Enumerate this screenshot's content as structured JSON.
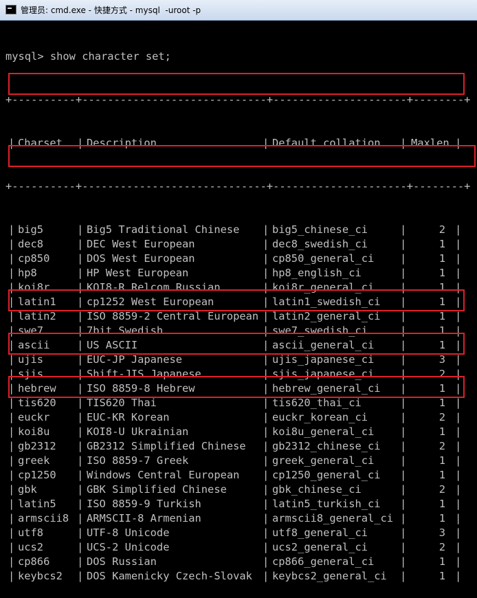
{
  "window": {
    "title": "管理员: cmd.exe - 快捷方式 - mysql  -uroot -p"
  },
  "console": {
    "command": "mysql> show character set;",
    "border": "+----------+-----------------------------+---------------------+--------+",
    "columns": [
      "Charset",
      "Description",
      "Default collation",
      "Maxlen"
    ],
    "rows": [
      [
        "big5",
        "Big5 Traditional Chinese",
        "big5_chinese_ci",
        "2"
      ],
      [
        "dec8",
        "DEC West European",
        "dec8_swedish_ci",
        "1"
      ],
      [
        "cp850",
        "DOS West European",
        "cp850_general_ci",
        "1"
      ],
      [
        "hp8",
        "HP West European",
        "hp8_english_ci",
        "1"
      ],
      [
        "koi8r",
        "KOI8-R Relcom Russian",
        "koi8r_general_ci",
        "1"
      ],
      [
        "latin1",
        "cp1252 West European",
        "latin1_swedish_ci",
        "1"
      ],
      [
        "latin2",
        "ISO 8859-2 Central European",
        "latin2_general_ci",
        "1"
      ],
      [
        "swe7",
        "7bit Swedish",
        "swe7_swedish_ci",
        "1"
      ],
      [
        "ascii",
        "US ASCII",
        "ascii_general_ci",
        "1"
      ],
      [
        "ujis",
        "EUC-JP Japanese",
        "ujis_japanese_ci",
        "3"
      ],
      [
        "sjis",
        "Shift-JIS Japanese",
        "sjis_japanese_ci",
        "2"
      ],
      [
        "hebrew",
        "ISO 8859-8 Hebrew",
        "hebrew_general_ci",
        "1"
      ],
      [
        "tis620",
        "TIS620 Thai",
        "tis620_thai_ci",
        "1"
      ],
      [
        "euckr",
        "EUC-KR Korean",
        "euckr_korean_ci",
        "2"
      ],
      [
        "koi8u",
        "KOI8-U Ukrainian",
        "koi8u_general_ci",
        "1"
      ],
      [
        "gb2312",
        "GB2312 Simplified Chinese",
        "gb2312_chinese_ci",
        "2"
      ],
      [
        "greek",
        "ISO 8859-7 Greek",
        "greek_general_ci",
        "1"
      ],
      [
        "cp1250",
        "Windows Central European",
        "cp1250_general_ci",
        "1"
      ],
      [
        "gbk",
        "GBK Simplified Chinese",
        "gbk_chinese_ci",
        "2"
      ],
      [
        "latin5",
        "ISO 8859-9 Turkish",
        "latin5_turkish_ci",
        "1"
      ],
      [
        "armscii8",
        "ARMSCII-8 Armenian",
        "armscii8_general_ci",
        "1"
      ],
      [
        "utf8",
        "UTF-8 Unicode",
        "utf8_general_ci",
        "3"
      ],
      [
        "ucs2",
        "UCS-2 Unicode",
        "ucs2_general_ci",
        "2"
      ],
      [
        "cp866",
        "DOS Russian",
        "cp866_general_ci",
        "1"
      ],
      [
        "keybcs2",
        "DOS Kamenicky Czech-Slovak",
        "keybcs2_general_ci",
        "1"
      ]
    ],
    "highlighted": [
      "big5",
      "latin1",
      "gb2312",
      "gbk",
      "utf8"
    ]
  },
  "colors": {
    "background": "#000000",
    "text": "#c0c0c0",
    "highlight_box": "#e0202a"
  }
}
